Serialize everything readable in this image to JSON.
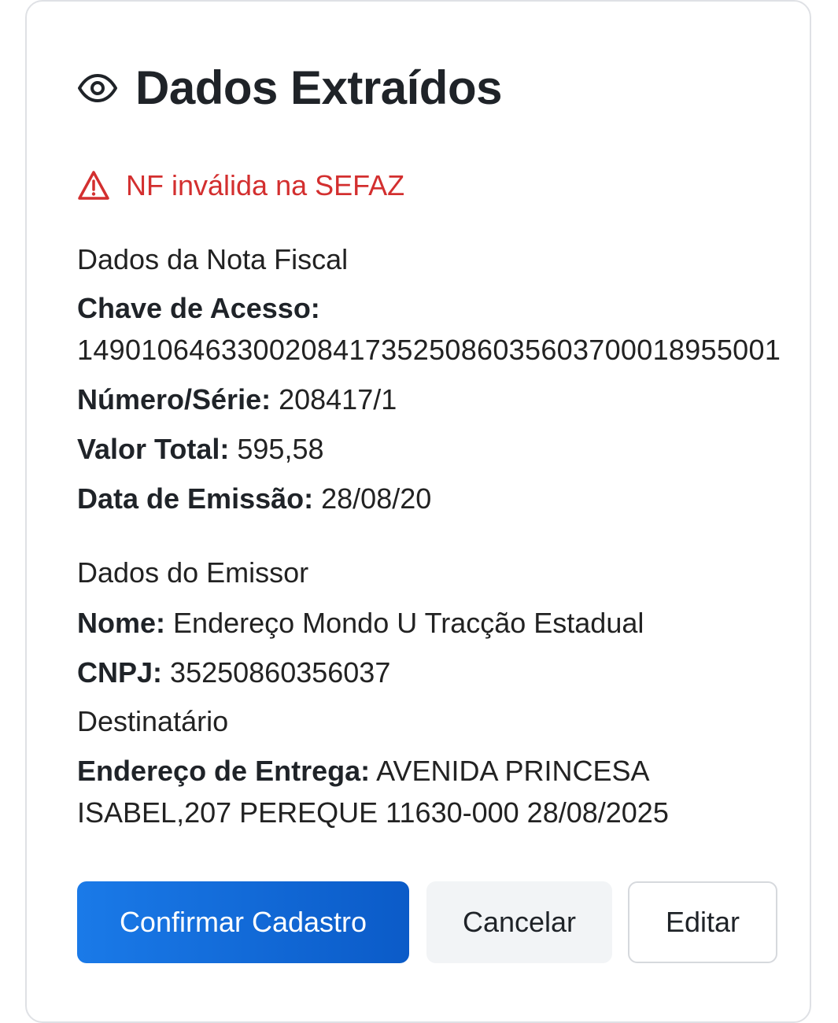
{
  "header": {
    "icon": "eye-icon",
    "title": "Dados Extraídos"
  },
  "alert": {
    "icon": "warning-triangle-icon",
    "text": "NF inválida na SEFAZ",
    "color": "#d32f2f"
  },
  "nota_fiscal": {
    "section_title": "Dados da Nota Fiscal",
    "chave_label": "Chave de Acesso:",
    "chave_value": "14901064633002084173525086035603700018955001",
    "numero_label": "Número/Série:",
    "numero_value": "208417/1",
    "valor_label": "Valor Total:",
    "valor_value": "595,58",
    "data_label": "Data de Emissão:",
    "data_value": "28/08/20"
  },
  "emissor": {
    "section_title": "Dados do Emissor",
    "nome_label": "Nome:",
    "nome_value": "Endereço Mondo U Tracção Estadual",
    "cnpj_label": "CNPJ:",
    "cnpj_value": "35250860356037"
  },
  "destinatario": {
    "section_title": "Destinatário",
    "endereco_label": "Endereço de Entrega:",
    "endereco_value_line1": "AVENIDA PRINCESA",
    "endereco_value_line2": "ISABEL,207 PEREQUE 11630-000 28/08/2025"
  },
  "actions": {
    "confirm_label": "Confirmar Cadastro",
    "cancel_label": "Cancelar",
    "edit_label": "Editar",
    "primary_color": "#1a7ae8"
  }
}
